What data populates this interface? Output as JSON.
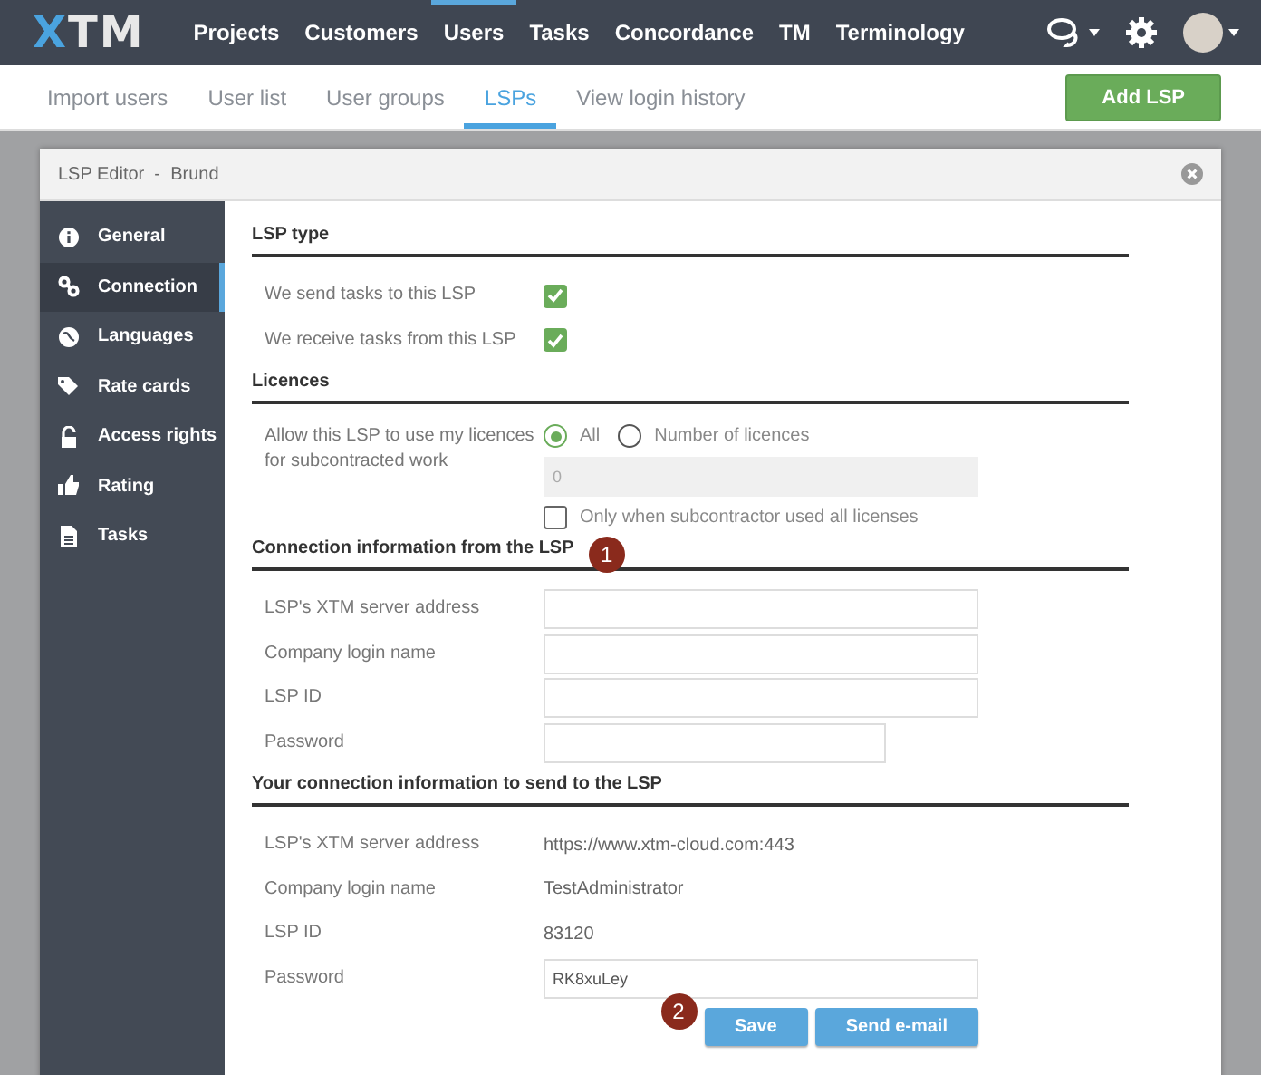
{
  "nav": {
    "logo": "XTM",
    "items": [
      {
        "label": "Projects",
        "selected": false
      },
      {
        "label": "Customers",
        "selected": false
      },
      {
        "label": "Users",
        "selected": true
      },
      {
        "label": "Tasks",
        "selected": false
      },
      {
        "label": "Concordance",
        "selected": false
      },
      {
        "label": "TM",
        "selected": false
      },
      {
        "label": "Terminology",
        "selected": false
      }
    ]
  },
  "subnav": {
    "tabs": [
      {
        "label": "Import users",
        "selected": false
      },
      {
        "label": "User list",
        "selected": false
      },
      {
        "label": "User groups",
        "selected": false
      },
      {
        "label": "LSPs",
        "selected": true
      },
      {
        "label": "View login history",
        "selected": false
      }
    ],
    "action": "Add LSP"
  },
  "modal": {
    "title": "LSP Editor  -  Brund",
    "sidebar": [
      {
        "label": "General",
        "selected": false
      },
      {
        "label": "Connection",
        "selected": true
      },
      {
        "label": "Languages",
        "selected": false
      },
      {
        "label": "Rate cards",
        "selected": false
      },
      {
        "label": "Access rights",
        "selected": false
      },
      {
        "label": "Rating",
        "selected": false
      },
      {
        "label": "Tasks",
        "selected": false
      }
    ],
    "sections": [
      {
        "title": "LSP type",
        "rows": [
          {
            "kind": "checkbox",
            "label": "We send tasks to this LSP",
            "checked": true
          },
          {
            "kind": "checkbox",
            "label": "We receive tasks from this LSP",
            "checked": true
          }
        ]
      },
      {
        "title": "Licences",
        "rows": [
          {
            "kind": "licences",
            "label": "Allow this LSP to use my licences for subcontracted work",
            "options": [
              {
                "label": "All",
                "selected": true
              },
              {
                "label": "Number of licences",
                "selected": false
              }
            ],
            "count": {
              "placeholder": "0",
              "disabled": true
            },
            "only_when": {
              "label": "Only when subcontractor used all licenses",
              "checked": false
            }
          }
        ]
      },
      {
        "title": "Connection information from the LSP",
        "badge": "1",
        "rows": [
          {
            "kind": "input",
            "label": "LSP's XTM server address"
          },
          {
            "kind": "input",
            "label": "Company login name"
          },
          {
            "kind": "input",
            "label": "LSP ID"
          },
          {
            "kind": "short-input",
            "label": "Password"
          }
        ]
      },
      {
        "title": "Your connection information to send to the LSP",
        "rows": [
          {
            "kind": "text",
            "label": "LSP's XTM server address",
            "value": "https://www.xtm-cloud.com:443"
          },
          {
            "kind": "text",
            "label": "Company login name",
            "value": "TestAdministrator"
          },
          {
            "kind": "text",
            "label": "LSP ID",
            "value": "83120"
          },
          {
            "kind": "input",
            "label": "Password",
            "value": "RK8xuLey"
          }
        ]
      }
    ],
    "buttons_badge": "2",
    "buttons": [
      "Save",
      "Send e-mail"
    ]
  }
}
